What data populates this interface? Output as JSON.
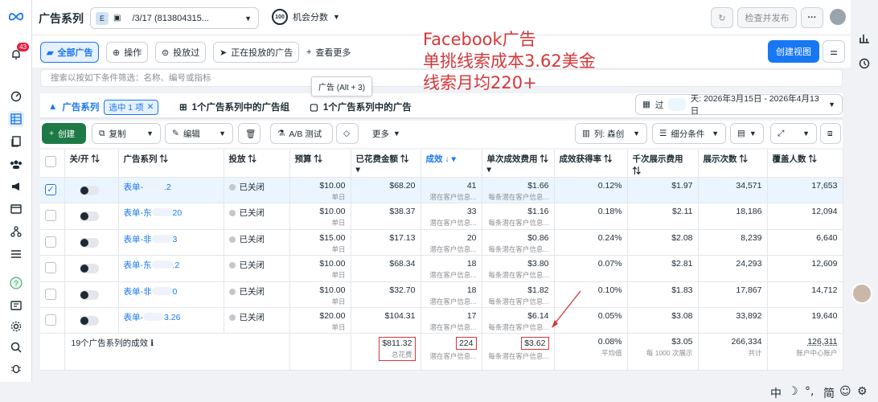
{
  "nav": {
    "notif_count": "43"
  },
  "topbar": {
    "title": "广告系列",
    "campaign_chip": "E",
    "campaign_label": "/3/17 (813804315...",
    "opportunity_score": "100",
    "opportunity_label": "机会分数",
    "review_publish": "检查并发布",
    "more": "···"
  },
  "tabs": {
    "all_ads": "全部广告",
    "actions": "操作",
    "delivered": "投放过",
    "active": "正在投放的广告",
    "see_more": "查看更多",
    "create_view": "创建视图"
  },
  "search": {
    "placeholder": "搜索以按如下条件筛选：名称、编号或指标"
  },
  "tooltip": "广告 (Alt + 3)",
  "levels": {
    "campaigns": "广告系列",
    "selected_chip": "选中 1 项",
    "adsets": "1个广告系列中的广告组",
    "ads": "1个广告系列中的广告",
    "date_prefix": "过",
    "date_range": "天: 2026年3月15日 - 2026年4月13日"
  },
  "toolbar": {
    "create": "创建",
    "copy": "复制",
    "edit": "编辑",
    "ab_test": "A/B 测试",
    "more": "更多",
    "columns": "列: 森创",
    "breakdown": "细分条件"
  },
  "annotation": {
    "line1": "Facebook广告",
    "line2": "单挑线索成本3.62美金",
    "line3": "线索月均220+"
  },
  "table": {
    "headers": {
      "onoff": "关/开",
      "campaign": "广告系列",
      "delivery": "投放",
      "budget": "预算",
      "spent": "已花费金额",
      "results": "成效",
      "cpr": "单次成效费用",
      "result_rate": "成效获得率",
      "cpm": "千次展示费用",
      "impressions": "展示次数",
      "reach": "覆盖人数"
    },
    "rows": [
      {
        "name_a": "表单-",
        "name_b": ".2",
        "status": "已关闭",
        "budget": "$10.00",
        "budget_sub": "单日",
        "spent": "$68.20",
        "results": "41",
        "results_sub": "潜在客户信息...",
        "cpr": "$1.66",
        "cpr_sub": "每条潜在客户信息...",
        "rate": "0.12%",
        "cpm": "$1.97",
        "impr": "34,571",
        "reach": "17,653",
        "checked": true
      },
      {
        "name_a": "表单-东",
        "name_b": "20",
        "status": "已关闭",
        "budget": "$10.00",
        "budget_sub": "单日",
        "spent": "$38.37",
        "results": "33",
        "results_sub": "潜在客户信息...",
        "cpr": "$1.16",
        "cpr_sub": "每条潜在客户信息...",
        "rate": "0.18%",
        "cpm": "$2.11",
        "impr": "18,186",
        "reach": "12,094",
        "checked": false
      },
      {
        "name_a": "表单-非",
        "name_b": "3",
        "status": "已关闭",
        "budget": "$15.00",
        "budget_sub": "单日",
        "spent": "$17.13",
        "results": "20",
        "results_sub": "潜在客户信息...",
        "cpr": "$0.86",
        "cpr_sub": "每条潜在客户信息...",
        "rate": "0.24%",
        "cpm": "$2.08",
        "impr": "8,239",
        "reach": "6,640",
        "checked": false
      },
      {
        "name_a": "表单-东",
        "name_b": ".2",
        "status": "已关闭",
        "budget": "$10.00",
        "budget_sub": "单日",
        "spent": "$68.34",
        "results": "18",
        "results_sub": "潜在客户信息...",
        "cpr": "$3.80",
        "cpr_sub": "每条潜在客户信息...",
        "rate": "0.07%",
        "cpm": "$2.81",
        "impr": "24,293",
        "reach": "12,609",
        "checked": false
      },
      {
        "name_a": "表单-非",
        "name_b": "0",
        "status": "已关闭",
        "budget": "$10.00",
        "budget_sub": "单日",
        "spent": "$32.70",
        "results": "18",
        "results_sub": "潜在客户信息...",
        "cpr": "$1.82",
        "cpr_sub": "每条潜在客户信息...",
        "rate": "0.10%",
        "cpm": "$1.83",
        "impr": "17,867",
        "reach": "14,712",
        "checked": false
      },
      {
        "name_a": "表单-",
        "name_b": "3.26",
        "status": "已关闭",
        "budget": "$20.00",
        "budget_sub": "单日",
        "spent": "$104.31",
        "results": "17",
        "results_sub": "潜在客户信息...",
        "cpr": "$6.14",
        "cpr_sub": "每条潜在客户信息...",
        "rate": "0.05%",
        "cpm": "$3.08",
        "impr": "33,892",
        "reach": "19,640",
        "checked": false
      }
    ],
    "total": {
      "label": "19个广告系列的成效",
      "spent": "$811.32",
      "spent_sub": "总花费",
      "results": "224",
      "results_sub": "潜在客户信息...",
      "cpr": "$3.62",
      "cpr_sub": "每条潜在客户信息...",
      "rate": "0.08%",
      "rate_sub": "平均值",
      "cpm": "$3.05",
      "cpm_sub": "每 1000 次展示",
      "impr": "266,334",
      "impr_sub": "共计",
      "reach": "126,311",
      "reach_sub": "账户中心账户"
    }
  },
  "statusbar": {
    "zh": "中",
    "moon": "☽",
    "punct": "°,",
    "simp": "简",
    "smile": "☺",
    "gear": "⚙"
  },
  "colors": {
    "accent": "#1877f2",
    "create_green": "#1d7a46",
    "annotation_red": "#d4373a"
  }
}
